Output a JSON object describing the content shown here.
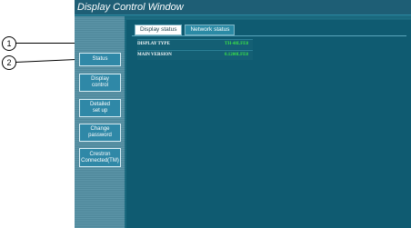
{
  "window": {
    "title": "Display Control Window"
  },
  "tabs": [
    {
      "label": "Display status",
      "active": true
    },
    {
      "label": "Network status",
      "active": false
    }
  ],
  "status": [
    {
      "label": "DISPLAY TYPE",
      "value": "TH-48LFE8"
    },
    {
      "label": "MAIN VERSION",
      "value": "0.1200LFE8"
    }
  ],
  "sidebar": {
    "buttons": [
      {
        "label": "Status"
      },
      {
        "label": "Display\ncontrol"
      },
      {
        "label": "Detailed\nset up"
      },
      {
        "label": "Change\npassword"
      },
      {
        "label": "Crestron\nConnected(TM)"
      }
    ]
  },
  "callouts": [
    "1",
    "2"
  ],
  "colors": {
    "title_bar": "#1e5e75",
    "main_bg": "#0f5b71",
    "sidebar_bg": "#5c95a8",
    "button_bg": "#2f88a7",
    "value_text": "#3be049"
  }
}
